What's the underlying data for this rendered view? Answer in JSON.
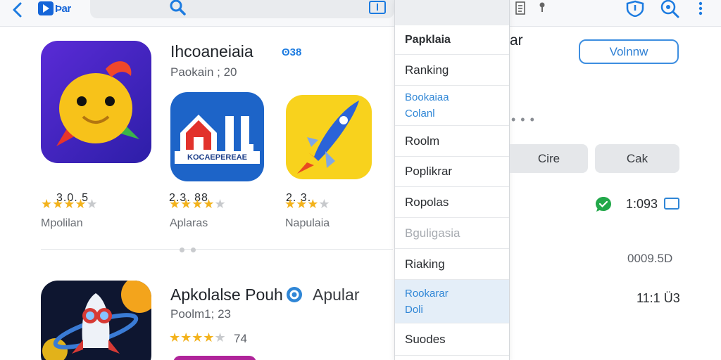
{
  "topbar": {
    "logo_text": "Þar"
  },
  "featured": {
    "title": "Ihcoaneiaia",
    "badge": "ʘ38",
    "subtitle": "Paokain ; 20"
  },
  "apps": [
    {
      "rating_label": "3.0. 5",
      "stars": 4,
      "category": "Mpolilan"
    },
    {
      "rating_label": "2.3. 88",
      "stars": 4,
      "category": "Aplaras",
      "icon_text": "KOCAEPEREAE"
    },
    {
      "rating_label": "2. 3.",
      "stars": 3,
      "category": "Napulaia"
    }
  ],
  "second_app": {
    "title": "Apkolalse Pouh",
    "tag": "Apular",
    "subtitle": "Poolm1; 23",
    "stars": 4,
    "rating_count": "74"
  },
  "dropdown": {
    "items": [
      {
        "label": "Papklaia"
      },
      {
        "label": "Ranking"
      },
      {
        "line1": "Bookaiaa",
        "line2": "Colanl"
      },
      {
        "label": "Roolm"
      },
      {
        "label": "Poplikrar"
      },
      {
        "label": "Ropolas"
      },
      {
        "label": "Bguligasia"
      },
      {
        "label": "Riaking"
      },
      {
        "line1": "Rookarar",
        "line2": "Doli"
      },
      {
        "label": "Suodes"
      }
    ]
  },
  "right_panel": {
    "title_suffix": "ar",
    "view_button": "Volnnw",
    "ellipsis": "• • •",
    "btn_left": "Cire",
    "btn_right": "Cak",
    "time": "1:093",
    "size": "0009.5D",
    "count": "11:1 Ü3"
  },
  "colors": {
    "accent": "#2f86d6",
    "star": "#f3b21b",
    "chat_green": "#22a84a"
  }
}
